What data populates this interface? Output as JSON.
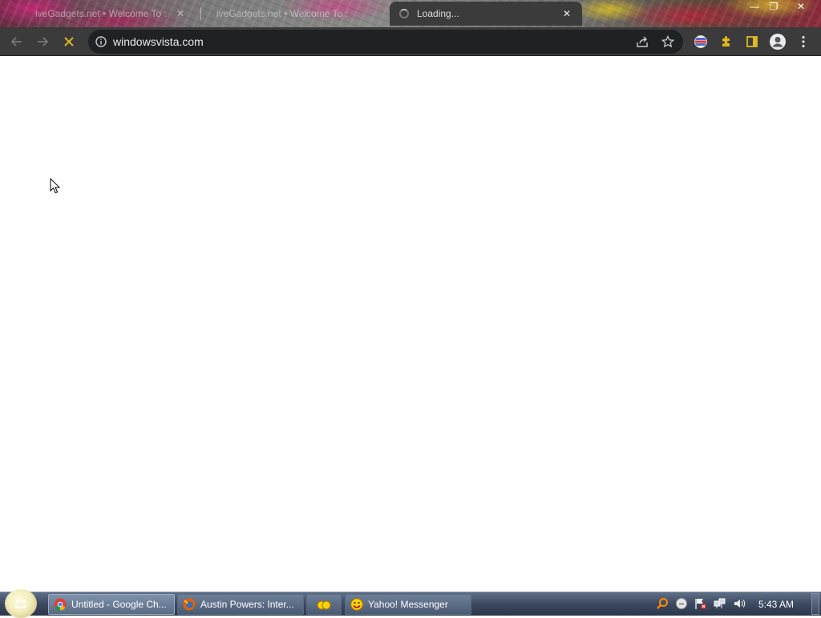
{
  "tabs": [
    {
      "title": "iveGadgets.net • Welcome To :",
      "close": "✕"
    },
    {
      "title": "iveGadgets.net • Welcome To :"
    },
    {
      "title": "Loading...",
      "close": "✕"
    }
  ],
  "window_controls": {
    "minimize": "—",
    "maximize": "❐",
    "close": "✕"
  },
  "toolbar": {
    "url": "windowsvista.com",
    "icons": [
      "back-icon",
      "forward-icon",
      "stop-icon",
      "info-icon",
      "share-icon",
      "star-icon",
      "vpn-extension-icon",
      "extensions-icon",
      "side-panel-icon",
      "profile-icon",
      "menu-icon"
    ]
  },
  "taskbar": {
    "buttons": [
      {
        "label": "Untitled - Google Ch...",
        "icon": "chrome-icon"
      },
      {
        "label": "Austin Powers: Inter...",
        "icon": "firefox-icon"
      },
      {
        "label": "",
        "icon": "messenger-group-icon"
      },
      {
        "label": "Yahoo! Messenger",
        "icon": "yahoo-messenger-icon"
      }
    ],
    "tray_icons": [
      "search-tray-icon",
      "messenger-status-icon",
      "flag-alert-icon",
      "network-icon",
      "volume-icon"
    ],
    "clock": "5:43 AM"
  },
  "colors": {
    "toolbar_bg": "#3b3b3b",
    "omnibox_bg": "#202124",
    "stop_icon": "#d9b32a",
    "extensions_icon": "#e0b820",
    "taskbar_top": "#5f6f86"
  }
}
